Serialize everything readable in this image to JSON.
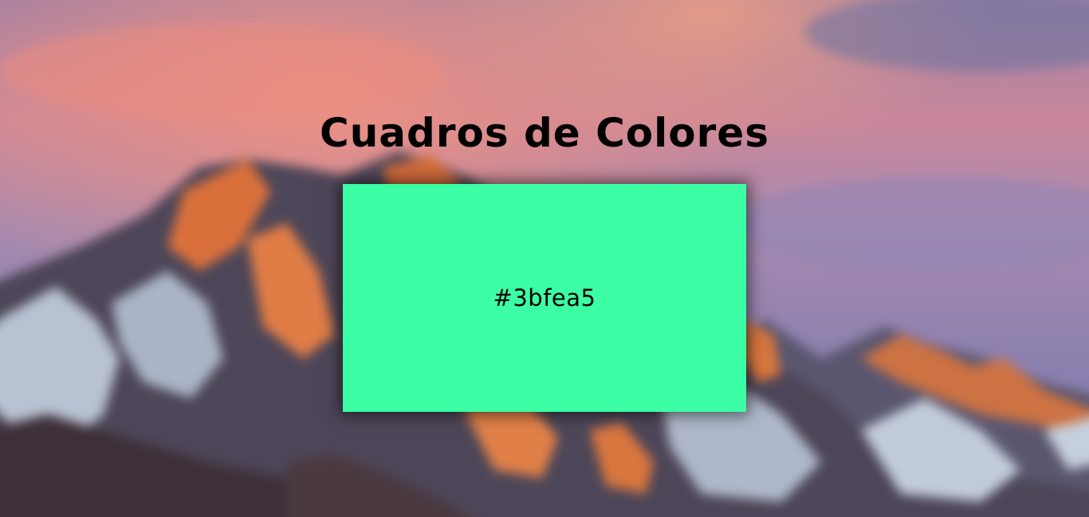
{
  "page": {
    "title": "Cuadros de Colores"
  },
  "color_box": {
    "code": "#3bfea5",
    "color": "#3bfea5"
  },
  "background": {
    "description_icon": "mountain-sunset-wallpaper",
    "sky_top": "#8a7fae",
    "sky_pink": "#e3867a",
    "mountain_orange": "#d9733f",
    "snow": "#b9c3d1",
    "rock": "#4a4452"
  }
}
